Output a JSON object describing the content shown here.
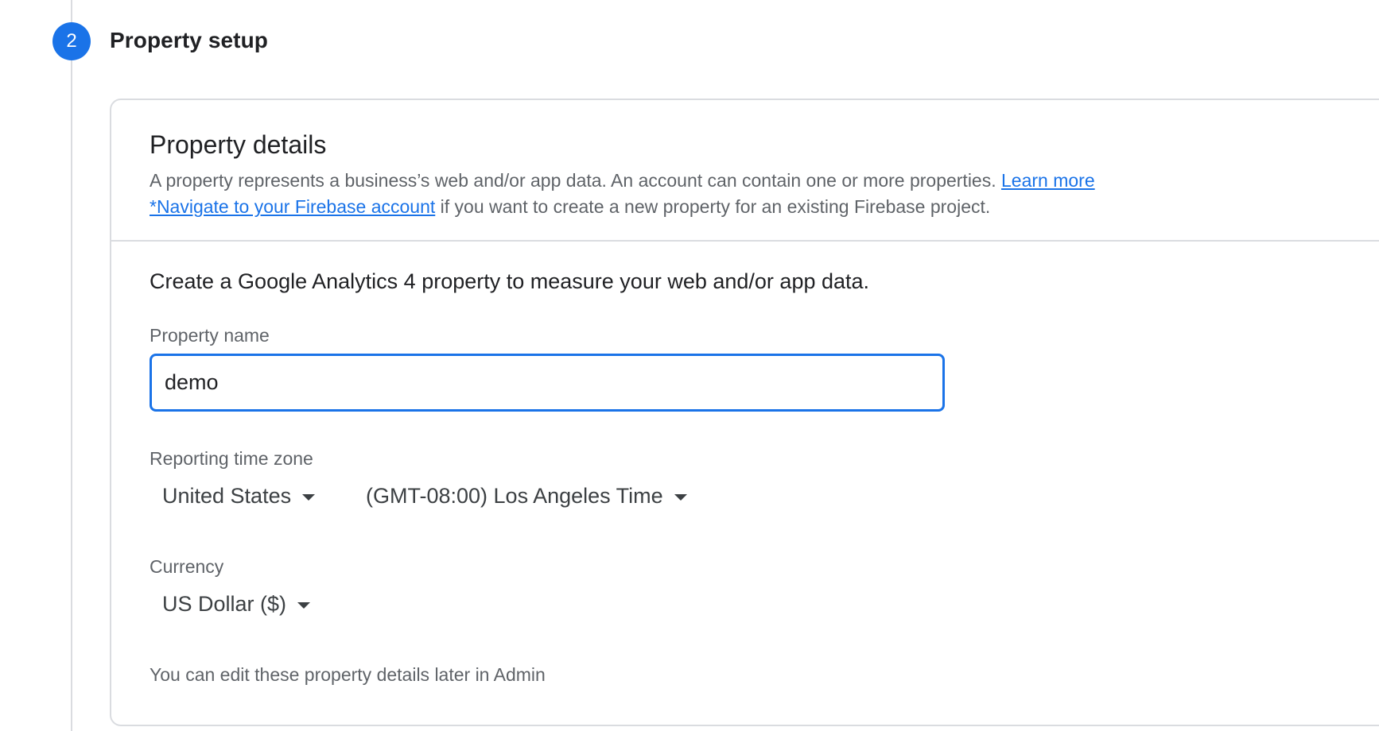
{
  "stepper": {
    "step_number": "2",
    "step_title": "Property setup"
  },
  "card": {
    "title": "Property details",
    "description_text": "A property represents a business’s web and/or app data. An account can contain one or more properties. ",
    "learn_more_link": "Learn more",
    "firebase_link": "*Navigate to your Firebase account",
    "firebase_suffix": " if you want to create a new property for an existing Firebase project.",
    "intro": "Create a Google Analytics 4 property to measure your web and/or app data.",
    "property_name_label": "Property name",
    "property_name_value": "demo",
    "timezone_label": "Reporting time zone",
    "country_value": "United States",
    "timezone_value": "(GMT-08:00) Los Angeles Time",
    "currency_label": "Currency",
    "currency_value": "US Dollar ($)",
    "footnote": "You can edit these property details later in Admin"
  },
  "colors": {
    "accent": "#1a73e8",
    "border": "#dadce0",
    "text_primary": "#202124",
    "text_secondary": "#5f6368"
  },
  "icons": {
    "dropdown": "caret-down-icon"
  }
}
